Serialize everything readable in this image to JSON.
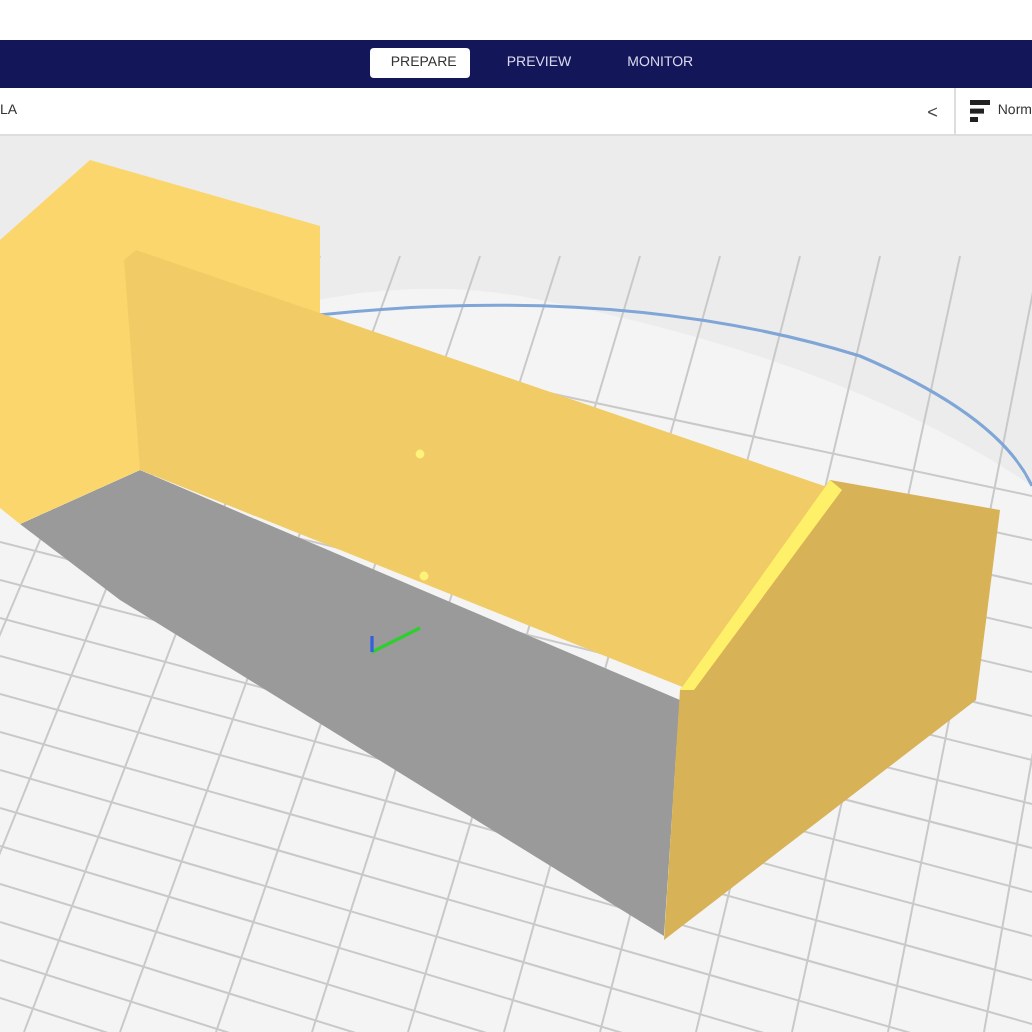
{
  "header": {
    "tabs": [
      {
        "label": "PREPARE",
        "selected": true
      },
      {
        "label": "PREVIEW",
        "selected": false
      },
      {
        "label": "MONITOR",
        "selected": false
      }
    ]
  },
  "toolbar": {
    "material": "LA",
    "collapse_glyph": "<",
    "profile": "Norm"
  }
}
